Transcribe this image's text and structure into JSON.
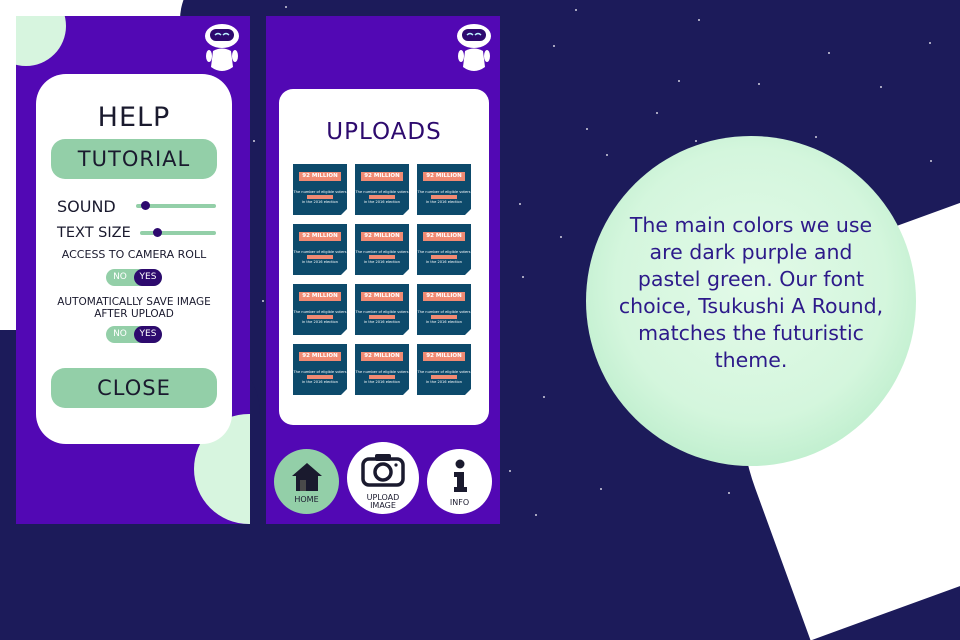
{
  "help_screen": {
    "title": "HELP",
    "tutorial_button": "TUTORIAL",
    "sound_label": "SOUND",
    "text_size_label": "TEXT SIZE",
    "camera_roll_label": "ACCESS TO CAMERA ROLL",
    "camera_roll_toggle": {
      "off": "NO",
      "on": "YES",
      "selected": "YES"
    },
    "autosave_label_line1": "AUTOMATICALLY SAVE IMAGE",
    "autosave_label_line2": "AFTER UPLOAD",
    "autosave_toggle": {
      "off": "NO",
      "on": "YES",
      "selected": "YES"
    },
    "close_button": "CLOSE"
  },
  "uploads_screen": {
    "title": "UPLOADS",
    "tiles": [
      {
        "amount": "92 MILLION",
        "line1": "The number of eligible voters",
        "line2": "in the 2016 election"
      },
      {
        "amount": "92 MILLION",
        "line1": "The number of eligible voters",
        "line2": "in the 2016 election"
      },
      {
        "amount": "92 MILLION",
        "line1": "The number of eligible voters",
        "line2": "in the 2016 election"
      },
      {
        "amount": "92 MILLION",
        "line1": "The number of eligible voters",
        "line2": "in the 2016 election"
      },
      {
        "amount": "92 MILLION",
        "line1": "The number of eligible voters",
        "line2": "in the 2016 election"
      },
      {
        "amount": "92 MILLION",
        "line1": "The number of eligible voters",
        "line2": "in the 2016 election"
      },
      {
        "amount": "92 MILLION",
        "line1": "The number of eligible voters",
        "line2": "in the 2016 election"
      },
      {
        "amount": "92 MILLION",
        "line1": "The number of eligible voters",
        "line2": "in the 2016 election"
      },
      {
        "amount": "92 MILLION",
        "line1": "The number of eligible voters",
        "line2": "in the 2016 election"
      },
      {
        "amount": "92 MILLION",
        "line1": "The number of eligible voters",
        "line2": "in the 2016 election"
      },
      {
        "amount": "92 MILLION",
        "line1": "The number of eligible voters",
        "line2": "in the 2016 election"
      },
      {
        "amount": "92 MILLION",
        "line1": "The number of eligible voters",
        "line2": "in the 2016 election"
      }
    ],
    "nav": {
      "home": "HOME",
      "upload_line1": "UPLOAD",
      "upload_line2": "IMAGE",
      "info": "INFO"
    }
  },
  "description": "The main colors we use are dark purple and pastel green. Our font choice, Tsukushi A Round, matches the futuristic theme.",
  "colors": {
    "dark_purple": "#5208b4",
    "pastel_green": "#93cfa8",
    "navy_background": "#1c1b5a",
    "tile_blue": "#0d4a6b",
    "tile_accent": "#f08a73"
  },
  "icons": [
    "robot-icon",
    "home-icon",
    "camera-icon",
    "info-icon"
  ]
}
